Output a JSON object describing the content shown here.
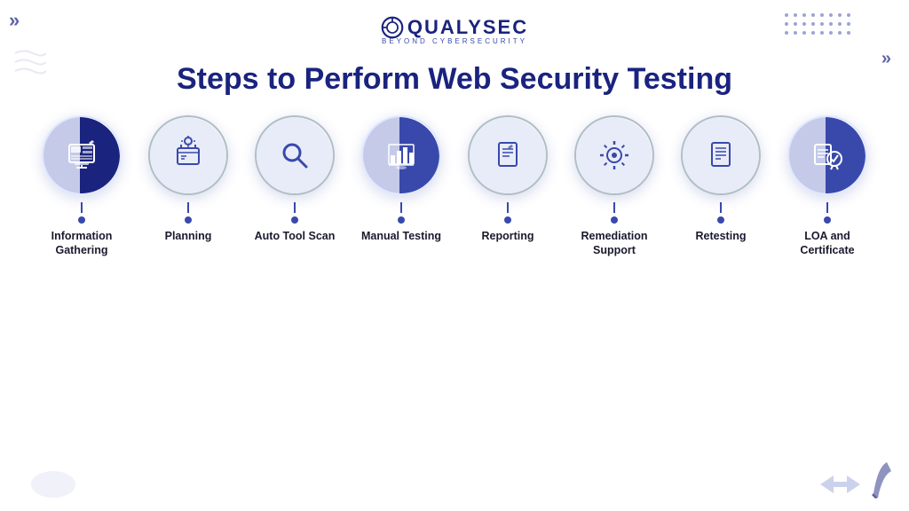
{
  "logo": {
    "name": "QUALYSEC",
    "tagline": "BEYOND CYBERSECURITY"
  },
  "page_title": "Steps to Perform Web Security Testing",
  "steps": [
    {
      "id": 1,
      "label": "Information Gathering",
      "icon_name": "information-gathering-icon",
      "icon_symbol": "📊"
    },
    {
      "id": 2,
      "label": "Planning",
      "icon_name": "planning-icon",
      "icon_symbol": "💡"
    },
    {
      "id": 3,
      "label": "Auto Tool Scan",
      "icon_name": "auto-tool-scan-icon",
      "icon_symbol": "🔍"
    },
    {
      "id": 4,
      "label": "Manual Testing",
      "icon_name": "manual-testing-icon",
      "icon_symbol": "📈"
    },
    {
      "id": 5,
      "label": "Reporting",
      "icon_name": "reporting-icon",
      "icon_symbol": "📋"
    },
    {
      "id": 6,
      "label": "Remediation Support",
      "icon_name": "remediation-support-icon",
      "icon_symbol": "⚙️"
    },
    {
      "id": 7,
      "label": "Retesting",
      "icon_name": "retesting-icon",
      "icon_symbol": "📄"
    },
    {
      "id": 8,
      "label": "LOA and Certificate",
      "icon_name": "loa-certificate-icon",
      "icon_symbol": "🏆"
    }
  ],
  "decorations": {
    "top_left_arrow": "»",
    "top_right_arrow": "»"
  }
}
